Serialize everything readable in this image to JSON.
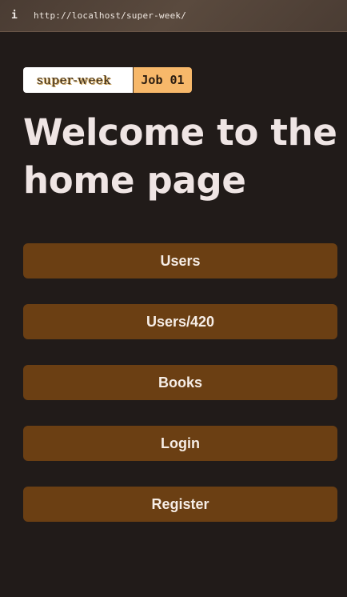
{
  "browser": {
    "info_icon": "i",
    "url": "http://localhost/super-week/"
  },
  "brand": {
    "logo_text": "super-week",
    "job_label": "Job 01"
  },
  "page": {
    "title": "Welcome to the home page"
  },
  "nav": {
    "items": [
      {
        "label": "Users"
      },
      {
        "label": "Users/420"
      },
      {
        "label": "Books"
      },
      {
        "label": "Login"
      },
      {
        "label": "Register"
      }
    ]
  },
  "colors": {
    "background": "#211b19",
    "button": "#6b3f13",
    "badge": "#f7b86a",
    "title_text": "#efe5e4"
  }
}
